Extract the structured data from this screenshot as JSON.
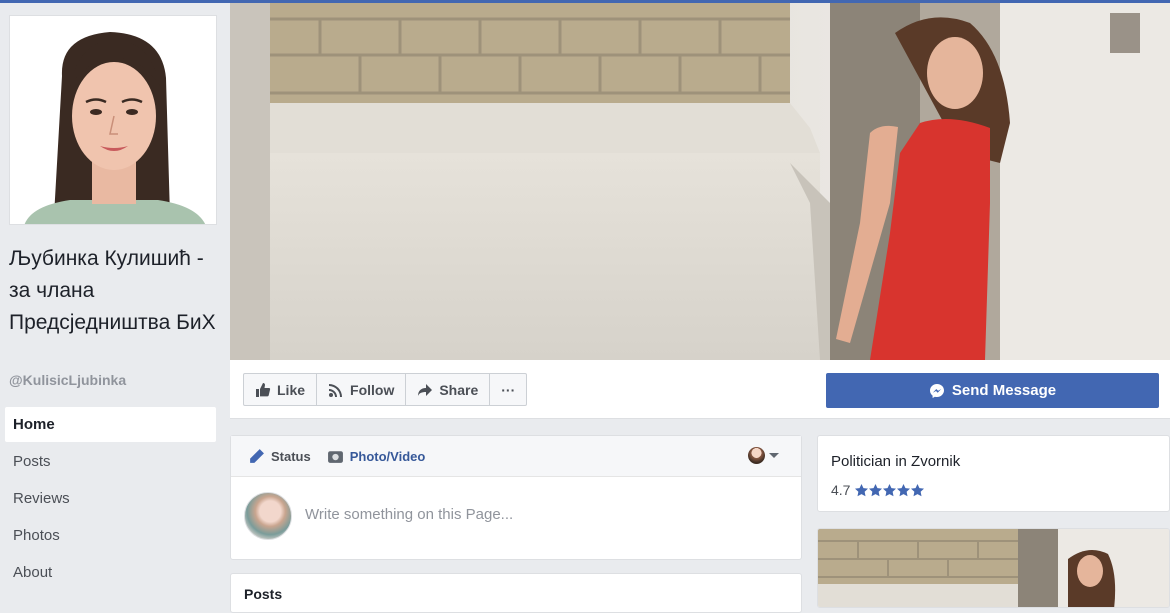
{
  "page": {
    "name": "Љубинка Кулишић - за члана Предсједништва БиХ",
    "handle": "@KulisicLjubinka"
  },
  "nav": {
    "items": [
      {
        "label": "Home",
        "active": true
      },
      {
        "label": "Posts"
      },
      {
        "label": "Reviews"
      },
      {
        "label": "Photos"
      },
      {
        "label": "About"
      }
    ]
  },
  "actions": {
    "like": "Like",
    "follow": "Follow",
    "share": "Share",
    "more": "···",
    "send_message": "Send Message"
  },
  "composer": {
    "status_tab": "Status",
    "photo_tab": "Photo/Video",
    "placeholder": "Write something on this Page..."
  },
  "posts": {
    "title": "Posts"
  },
  "about": {
    "category": "Politician in Zvornik",
    "rating": "4.7"
  },
  "colors": {
    "brand": "#4267b2",
    "link": "#365899",
    "background": "#e9ebee"
  }
}
